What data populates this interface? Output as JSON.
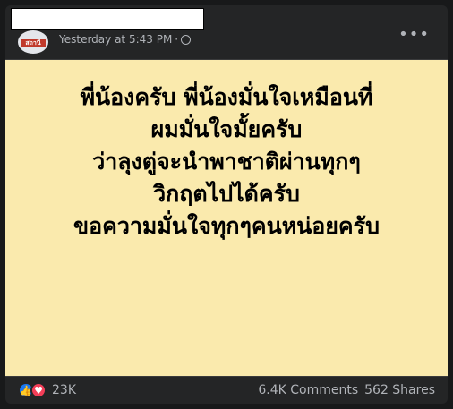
{
  "post": {
    "author_redacted": "",
    "timestamp": "Yesterday at 5:43 PM",
    "separator": "·",
    "more_label": "•••",
    "avatar_logo_text": "สถานี",
    "text_lines": [
      "พี่น้องครับ พี่น้องมั่นใจเหมือนที่",
      "ผมมั่นใจมั้ยครับ",
      "ว่าลุงตู่จะนำพาชาติผ่านทุกๆ",
      "วิกฤตไปได้ครับ",
      "ขอความมั่นใจทุกๆคนหน่อยครับ"
    ],
    "background_color": "#faeaad"
  },
  "footer": {
    "reaction_count": "23K",
    "comments": "6.4K Comments",
    "shares": "562 Shares"
  },
  "icons": {
    "like": "like-icon",
    "love": "love-icon",
    "globe": "globe-icon"
  }
}
